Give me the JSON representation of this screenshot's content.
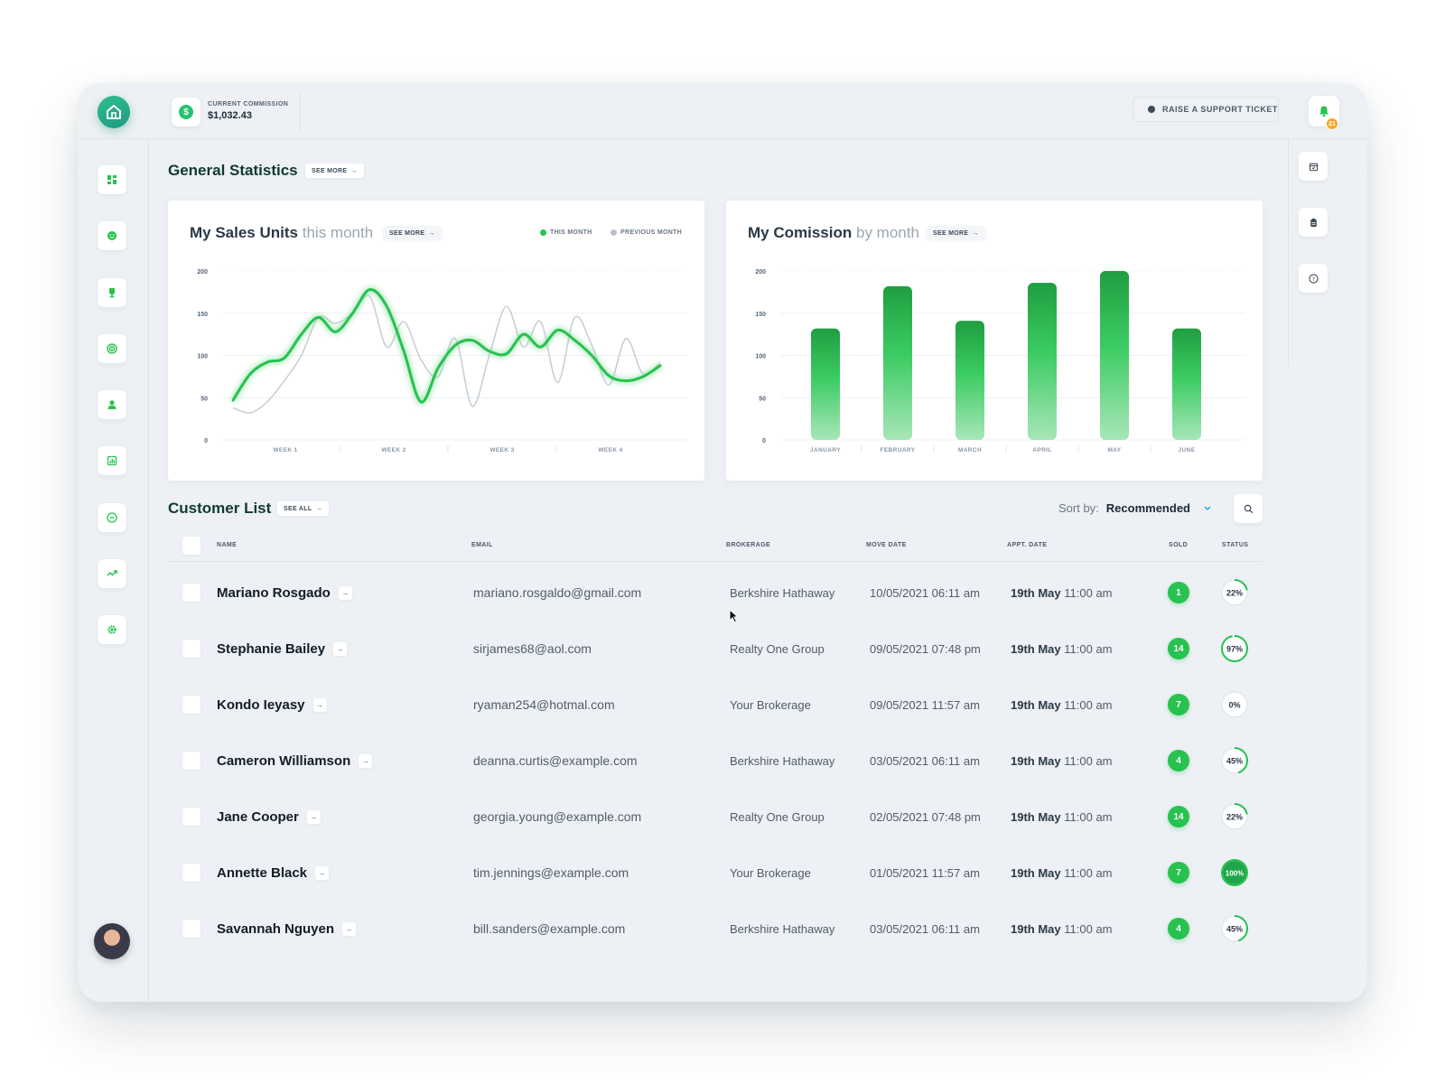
{
  "header": {
    "commission_label": "CURRENT COMMISSION",
    "commission_value": "$1,032.43",
    "support_label": "RAISE A SUPPORT TICKET",
    "notification_count": "21"
  },
  "sidebar": {
    "items": [
      "dashboard",
      "customers",
      "properties",
      "analytics",
      "agents",
      "reports",
      "messages",
      "trends",
      "settings"
    ]
  },
  "right_rail": {
    "items": [
      "calendar",
      "clipboard",
      "help"
    ]
  },
  "general_statistics": {
    "title": "General Statistics",
    "see_more": "SEE MORE"
  },
  "sales_card": {
    "title": "My Sales Units",
    "subtitle": "this month",
    "see_more": "SEE MORE",
    "legend_this": "THIS MONTH",
    "legend_prev": "PREVIOUS MONTH"
  },
  "commission_card": {
    "title": "My Comission",
    "subtitle": "by month",
    "see_more": "SEE MORE"
  },
  "chart_data": [
    {
      "type": "line",
      "title": "My Sales Units this month",
      "ylim": [
        0,
        200
      ],
      "yticks": [
        "200",
        "150",
        "100",
        "50",
        "0"
      ],
      "xticks": [
        "WEEK 1",
        "WEEK 2",
        "WEEK 3",
        "WEEK 4"
      ],
      "x": [
        0,
        0.04,
        0.08,
        0.12,
        0.16,
        0.2,
        0.24,
        0.28,
        0.32,
        0.36,
        0.4,
        0.44,
        0.48,
        0.52,
        0.56,
        0.6,
        0.64,
        0.68,
        0.72,
        0.76,
        0.8,
        0.84,
        0.88,
        0.92,
        0.96,
        1.0
      ],
      "series": [
        {
          "name": "THIS MONTH",
          "color": "#27c24f",
          "values": [
            47,
            78,
            92,
            97,
            125,
            145,
            128,
            150,
            178,
            158,
            105,
            45,
            85,
            112,
            118,
            105,
            102,
            125,
            110,
            130,
            118,
            100,
            76,
            70,
            75,
            88
          ]
        },
        {
          "name": "PREVIOUS MONTH",
          "color": "#c8cfd7",
          "values": [
            38,
            32,
            45,
            70,
            100,
            145,
            138,
            150,
            170,
            110,
            140,
            95,
            75,
            120,
            40,
            100,
            158,
            110,
            140,
            68,
            145,
            112,
            65,
            120,
            78,
            92
          ]
        }
      ]
    },
    {
      "type": "bar",
      "title": "My Comission by month",
      "ylim": [
        0,
        200
      ],
      "yticks": [
        "200",
        "150",
        "100",
        "50",
        "0"
      ],
      "categories": [
        "JANUARY",
        "FEBRUARY",
        "MARCH",
        "APRIL",
        "MAY",
        "JUNE"
      ],
      "values": [
        132,
        182,
        141,
        186,
        200,
        132
      ],
      "color": "#27c24f"
    }
  ],
  "customer_list": {
    "title": "Customer List",
    "see_all": "SEE ALL",
    "sort_label": "Sort by:",
    "sort_value": "Recommended",
    "columns": [
      "NAME",
      "EMAIL",
      "BROKERAGE",
      "MOVE DATE",
      "APPT. DATE",
      "SOLD",
      "STATUS"
    ],
    "rows": [
      {
        "name": "Mariano Rosgado",
        "email": "mariano.rosgaldo@gmail.com",
        "brokerage": "Berkshire Hathaway",
        "move_date": "10/05/2021 06:11 am",
        "appt_day": "19th May",
        "appt_time": "11:00 am",
        "sold": "1",
        "status": "22%",
        "status_value": 0.22
      },
      {
        "name": "Stephanie Bailey",
        "email": "sirjames68@aol.com",
        "brokerage": "Realty One Group",
        "move_date": "09/05/2021 07:48 pm",
        "appt_day": "19th May",
        "appt_time": "11:00 am",
        "sold": "14",
        "status": "97%",
        "status_value": 0.97
      },
      {
        "name": "Kondo Ieyasy",
        "email": "ryaman254@hotmal.com",
        "brokerage": "Your Brokerage",
        "move_date": "09/05/2021 11:57 am",
        "appt_day": "19th May",
        "appt_time": "11:00 am",
        "sold": "7",
        "status": "0%",
        "status_value": 0
      },
      {
        "name": "Cameron Williamson",
        "email": "deanna.curtis@example.com",
        "brokerage": "Berkshire Hathaway",
        "move_date": "03/05/2021 06:11 am",
        "appt_day": "19th May",
        "appt_time": "11:00 am",
        "sold": "4",
        "status": "45%",
        "status_value": 0.45
      },
      {
        "name": "Jane Cooper",
        "email": "georgia.young@example.com",
        "brokerage": "Realty One Group",
        "move_date": "02/05/2021 07:48 pm",
        "appt_day": "19th May",
        "appt_time": "11:00 am",
        "sold": "14",
        "status": "22%",
        "status_value": 0.22
      },
      {
        "name": "Annette Black",
        "email": "tim.jennings@example.com",
        "brokerage": "Your Brokerage",
        "move_date": "01/05/2021 11:57 am",
        "appt_day": "19th May",
        "appt_time": "11:00 am",
        "sold": "7",
        "status": "100%",
        "status_value": 1
      },
      {
        "name": "Savannah Nguyen",
        "email": "bill.sanders@example.com",
        "brokerage": "Berkshire Hathaway",
        "move_date": "03/05/2021 06:11 am",
        "appt_day": "19th May",
        "appt_time": "11:00 am",
        "sold": "4",
        "status": "45%",
        "status_value": 0.45
      }
    ]
  },
  "colors": {
    "accent": "#27c24f",
    "title": "#0f3a33",
    "background": "#edf0f4"
  }
}
